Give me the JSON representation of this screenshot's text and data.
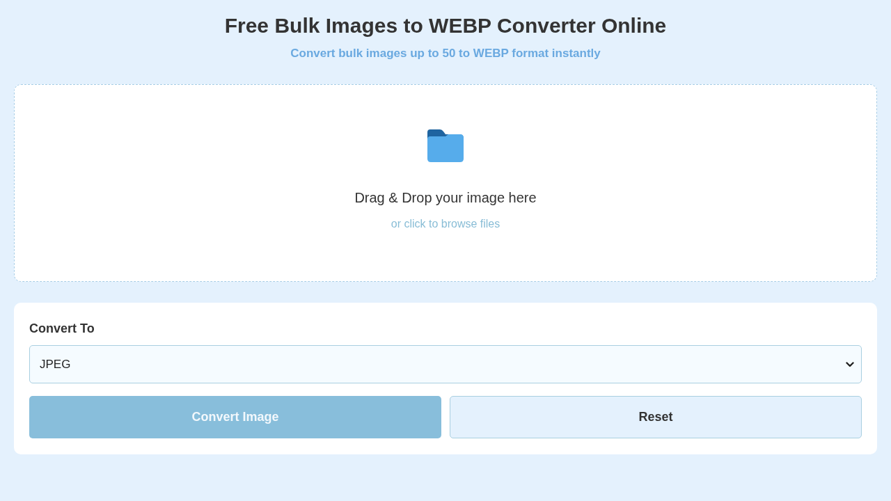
{
  "header": {
    "title": "Free Bulk Images to WEBP Converter Online",
    "subtitle": "Convert bulk images up to 50 to WEBP format instantly"
  },
  "drop_zone": {
    "prompt": "Drag & Drop your image here",
    "browse_link": "or click to browse files"
  },
  "settings": {
    "label": "Convert To",
    "format_select": {
      "value": "JPEG"
    }
  },
  "buttons": [
    {
      "kind": "primary",
      "label": "Convert Image",
      "disabled": true
    },
    {
      "kind": "secondary",
      "label": "Reset",
      "disabled": false
    }
  ]
}
